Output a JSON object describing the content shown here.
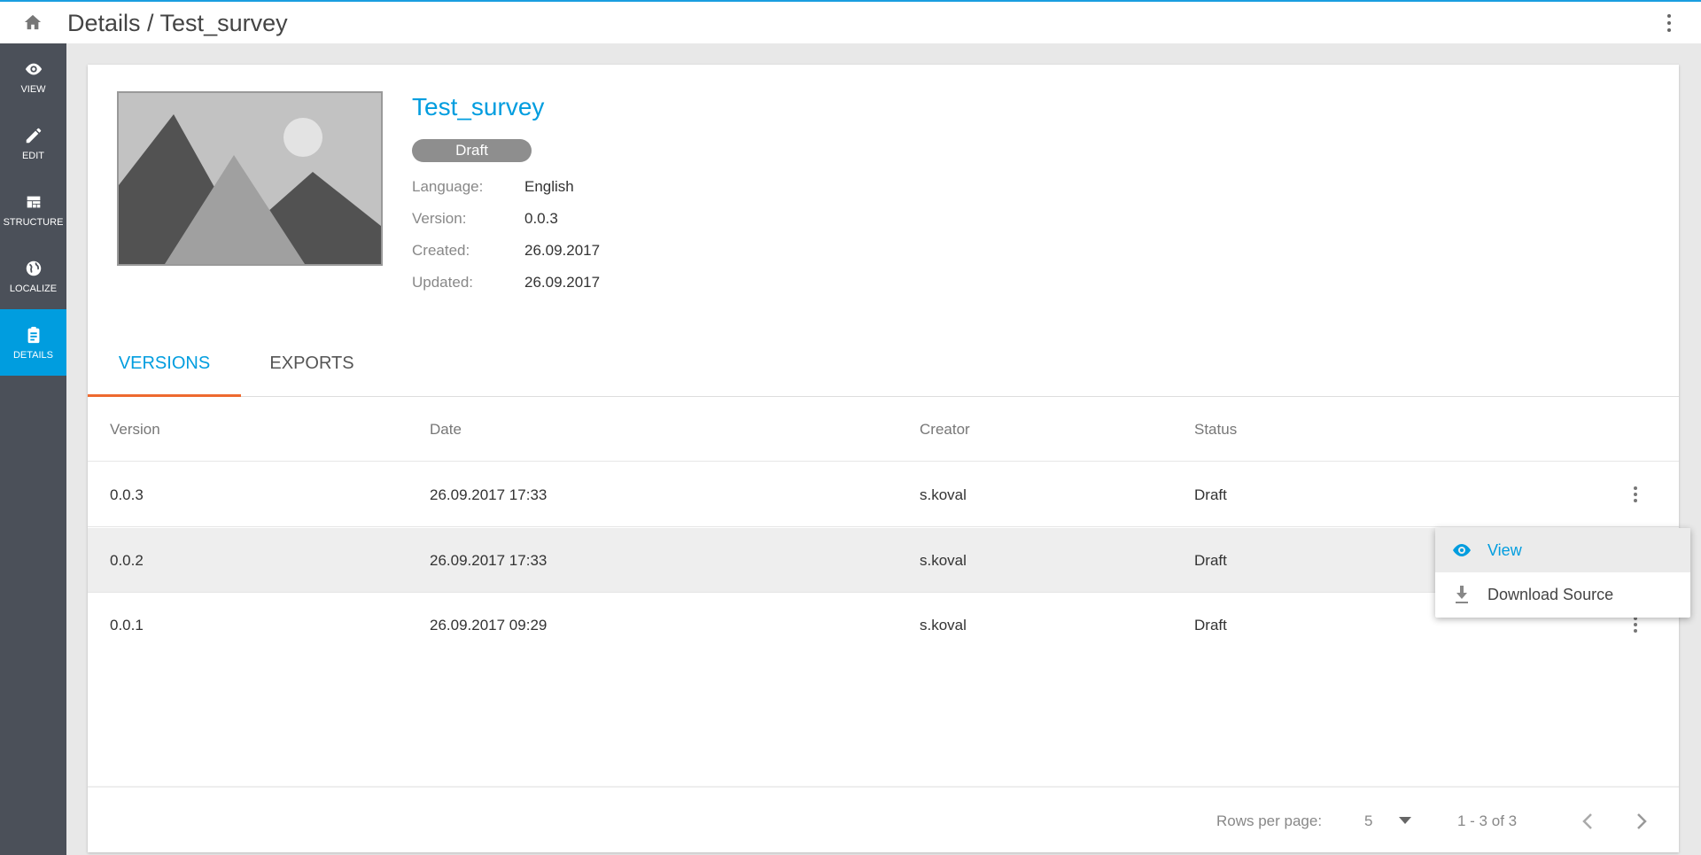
{
  "header": {
    "breadcrumb": "Details / Test_survey"
  },
  "sidebar": {
    "items": [
      {
        "label": "VIEW"
      },
      {
        "label": "EDIT"
      },
      {
        "label": "STRUCTURE"
      },
      {
        "label": "LOCALIZE"
      },
      {
        "label": "DETAILS"
      }
    ]
  },
  "survey": {
    "title": "Test_survey",
    "status": "Draft",
    "fields": [
      {
        "label": "Language:",
        "value": "English"
      },
      {
        "label": "Version:",
        "value": "0.0.3"
      },
      {
        "label": "Created:",
        "value": "26.09.2017"
      },
      {
        "label": "Updated:",
        "value": "26.09.2017"
      }
    ]
  },
  "tabs": [
    {
      "label": "VERSIONS"
    },
    {
      "label": "EXPORTS"
    }
  ],
  "table": {
    "headers": [
      "Version",
      "Date",
      "Creator",
      "Status"
    ],
    "rows": [
      [
        "0.0.3",
        "26.09.2017 17:33",
        "s.koval",
        "Draft"
      ],
      [
        "0.0.2",
        "26.09.2017 17:33",
        "s.koval",
        "Draft"
      ],
      [
        "0.0.1",
        "26.09.2017 09:29",
        "s.koval",
        "Draft"
      ]
    ]
  },
  "menu": {
    "items": [
      {
        "label": "View"
      },
      {
        "label": "Download Source"
      }
    ]
  },
  "pagination": {
    "rows_label": "Rows per page:",
    "rows_value": "5",
    "range": "1 - 3 of 3"
  },
  "colors": {
    "accent": "#009ddf",
    "tab_indicator": "#ee6a2f",
    "sidebar": "#4b5059"
  }
}
